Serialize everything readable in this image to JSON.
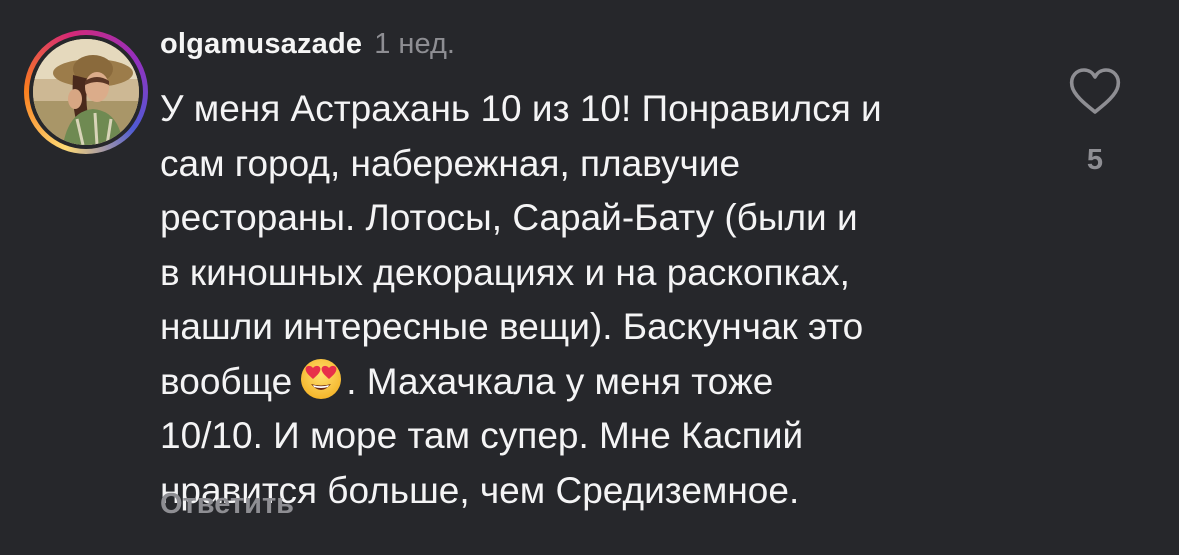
{
  "comment": {
    "username": "olgamusazade",
    "time": "1 нед.",
    "text_lines": [
      "У меня Астрахань 10 из 10! Понравился и",
      "сам город, набережная, плавучие",
      "рестораны. Лотосы, Сарай-Бату (были и",
      "в киношных декорациях и на раскопках,",
      "нашли интересные вещи). Баскунчак это",
      "вообще",
      ". Махачкала у меня тоже",
      "10/10. И море там супер. Мне Каспий",
      "нравится больше, чем Средиземное."
    ],
    "emoji": "heart-eyes-emoji",
    "reply_label": "Ответить",
    "like_count": "5"
  },
  "colors": {
    "background": "#26272b",
    "text": "#f4f4f5",
    "muted": "#8e8e93"
  }
}
